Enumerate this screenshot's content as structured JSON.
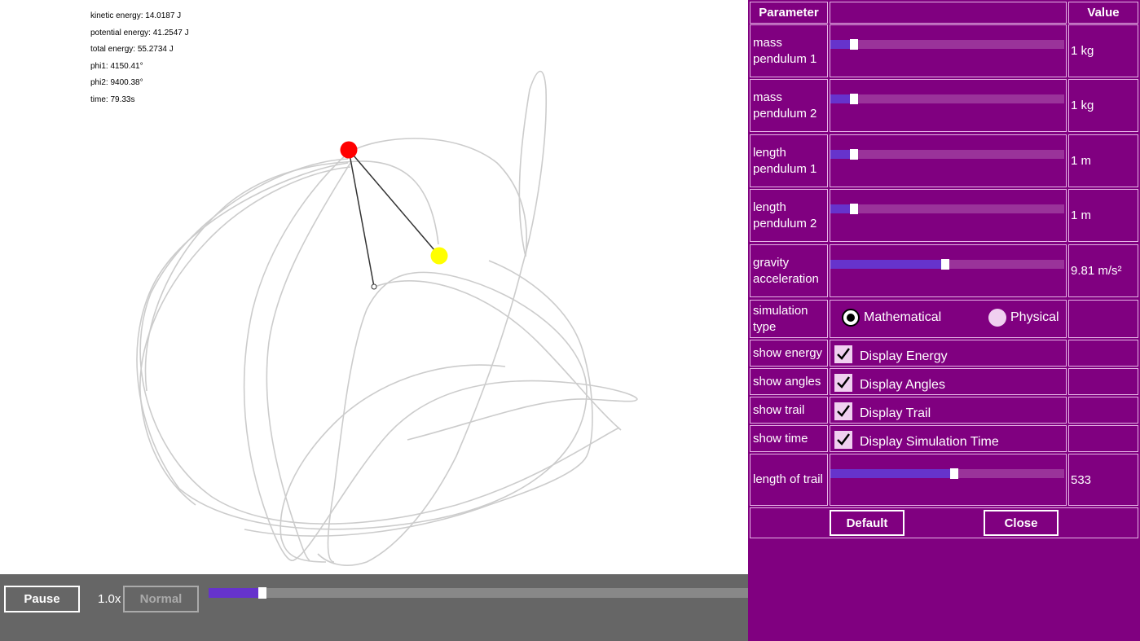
{
  "readouts": {
    "kinetic": "kinetic energy: 14.0187 J",
    "potential": "potential energy: 41.2547 J",
    "total": "total energy: 55.2734 J",
    "phi1": "phi1: 4150.41°",
    "phi2": "phi2: 9400.38°",
    "time": "time: 79.33s"
  },
  "colors": {
    "pendulum1": "#ff0000",
    "pendulum2": "#ffff00",
    "trail": "#cccccc",
    "panel_bg": "#800080",
    "slider_fill": "#6633cc"
  },
  "bottom_bar": {
    "pause_label": "Pause",
    "speed_value": "1.0x",
    "normal_label": "Normal",
    "speed_slider_fraction": 0.1
  },
  "panel": {
    "headers": {
      "parameter": "Parameter",
      "middle": "",
      "value": "Value"
    },
    "rows": [
      {
        "label": "mass pendulum 1",
        "value": "1 kg",
        "slider_fraction": 0.1
      },
      {
        "label": "mass pendulum 2",
        "value": "1 kg",
        "slider_fraction": 0.1
      },
      {
        "label": "length pendulum 1",
        "value": "1 m",
        "slider_fraction": 0.1
      },
      {
        "label": "length pendulum 2",
        "value": "1 m",
        "slider_fraction": 0.1
      },
      {
        "label": "gravity acceleration",
        "value": "9.81 m/s²",
        "slider_fraction": 0.49
      }
    ],
    "simulation_type": {
      "label": "simulation type",
      "option_mathematical": "Mathematical",
      "option_physical": "Physical",
      "selected": "Mathematical"
    },
    "toggles": [
      {
        "label": "show energy",
        "text": "Display Energy",
        "checked": true
      },
      {
        "label": "show angles",
        "text": "Display Angles",
        "checked": true
      },
      {
        "label": "show trail",
        "text": "Display Trail",
        "checked": true
      },
      {
        "label": "show time",
        "text": "Display Simulation Time",
        "checked": true
      }
    ],
    "trail_length": {
      "label": "length of trail",
      "value": "533",
      "slider_fraction": 0.53
    },
    "default_label": "Default",
    "close_label": "Close"
  }
}
